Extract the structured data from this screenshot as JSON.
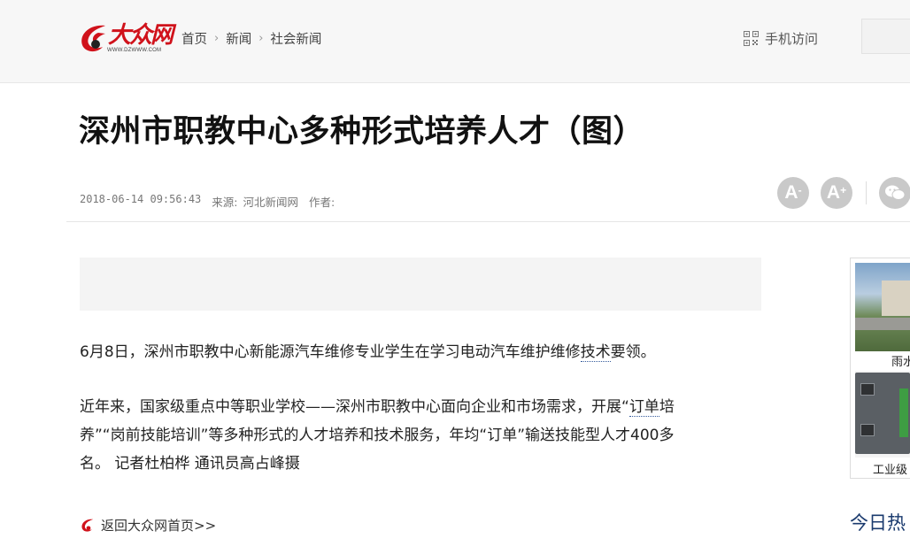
{
  "header": {
    "logo_text": "大众网",
    "logo_url": "WWW.DZWWW.COM",
    "breadcrumb": [
      "首页",
      "新闻",
      "社会新闻"
    ],
    "mobile_label": "手机访问"
  },
  "article": {
    "title": "深州市职教中心多种形式培养人才（图）",
    "date": "2018-06-14 09:56:43",
    "source_label": "来源:",
    "source": "河北新闻网",
    "author_label": "作者:",
    "p1_before": "6月8日，深州市职教中心新能源汽车维修专业学生在学习电动汽车维护维修",
    "p1_link": "技术",
    "p1_after": "要领。",
    "p2_line1_before": "近年来，国家级重点中等职业学校——深州市职教中心面向企业和市场需求，开展“",
    "p2_link": "订单",
    "p2_line1_after": "培",
    "p2_line2": "养”“岗前技能培训”等多种形式的人才培养和技术服务，年均“订单”输送技能型人才400多",
    "p2_line3": "名。 记者杜柏桦 通讯员高占峰摄",
    "back_link": "返回大众网首页>>"
  },
  "tools": {
    "font_decrease": "A",
    "font_decrease_sup": "-",
    "font_increase": "A",
    "font_increase_sup": "+"
  },
  "sidebar": {
    "caption1": "雨水",
    "caption2": "工业级",
    "hot_title": "今日热"
  },
  "colors": {
    "brand_red": "#d0121b",
    "link_navy": "#1a3a6e",
    "tool_grey": "#c9c9c9"
  },
  "icons": [
    "qr-code-icon",
    "logo-swirl-icon",
    "wechat-icon",
    "home-swirl-icon"
  ]
}
